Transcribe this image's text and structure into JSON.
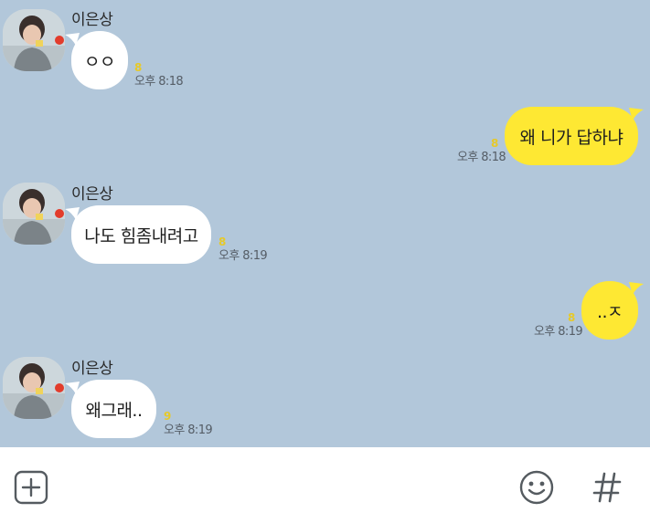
{
  "chat": {
    "background_color": "#b2c7da",
    "incoming_bubble_color": "#ffffff",
    "outgoing_bubble_color": "#fee833",
    "messages": [
      {
        "direction": "incoming",
        "sender": "이은상",
        "text": "ㅇㅇ",
        "unread": "8",
        "time": "오후 8:18"
      },
      {
        "direction": "outgoing",
        "text": "왜 니가 답하냐",
        "unread": "8",
        "time": "오후 8:18"
      },
      {
        "direction": "incoming",
        "sender": "이은상",
        "text": "나도 힘좀내려고",
        "unread": "8",
        "time": "오후 8:19"
      },
      {
        "direction": "outgoing",
        "text": "..ㅈ",
        "unread": "8",
        "time": "오후 8:19"
      },
      {
        "direction": "incoming",
        "sender": "이은상",
        "text": "왜그래..",
        "unread": "9",
        "time": "오후 8:19"
      }
    ]
  },
  "input_bar": {
    "attach_icon": "plus-box-icon",
    "emoji_icon": "smiley-icon",
    "hashtag_icon": "hash-icon"
  }
}
